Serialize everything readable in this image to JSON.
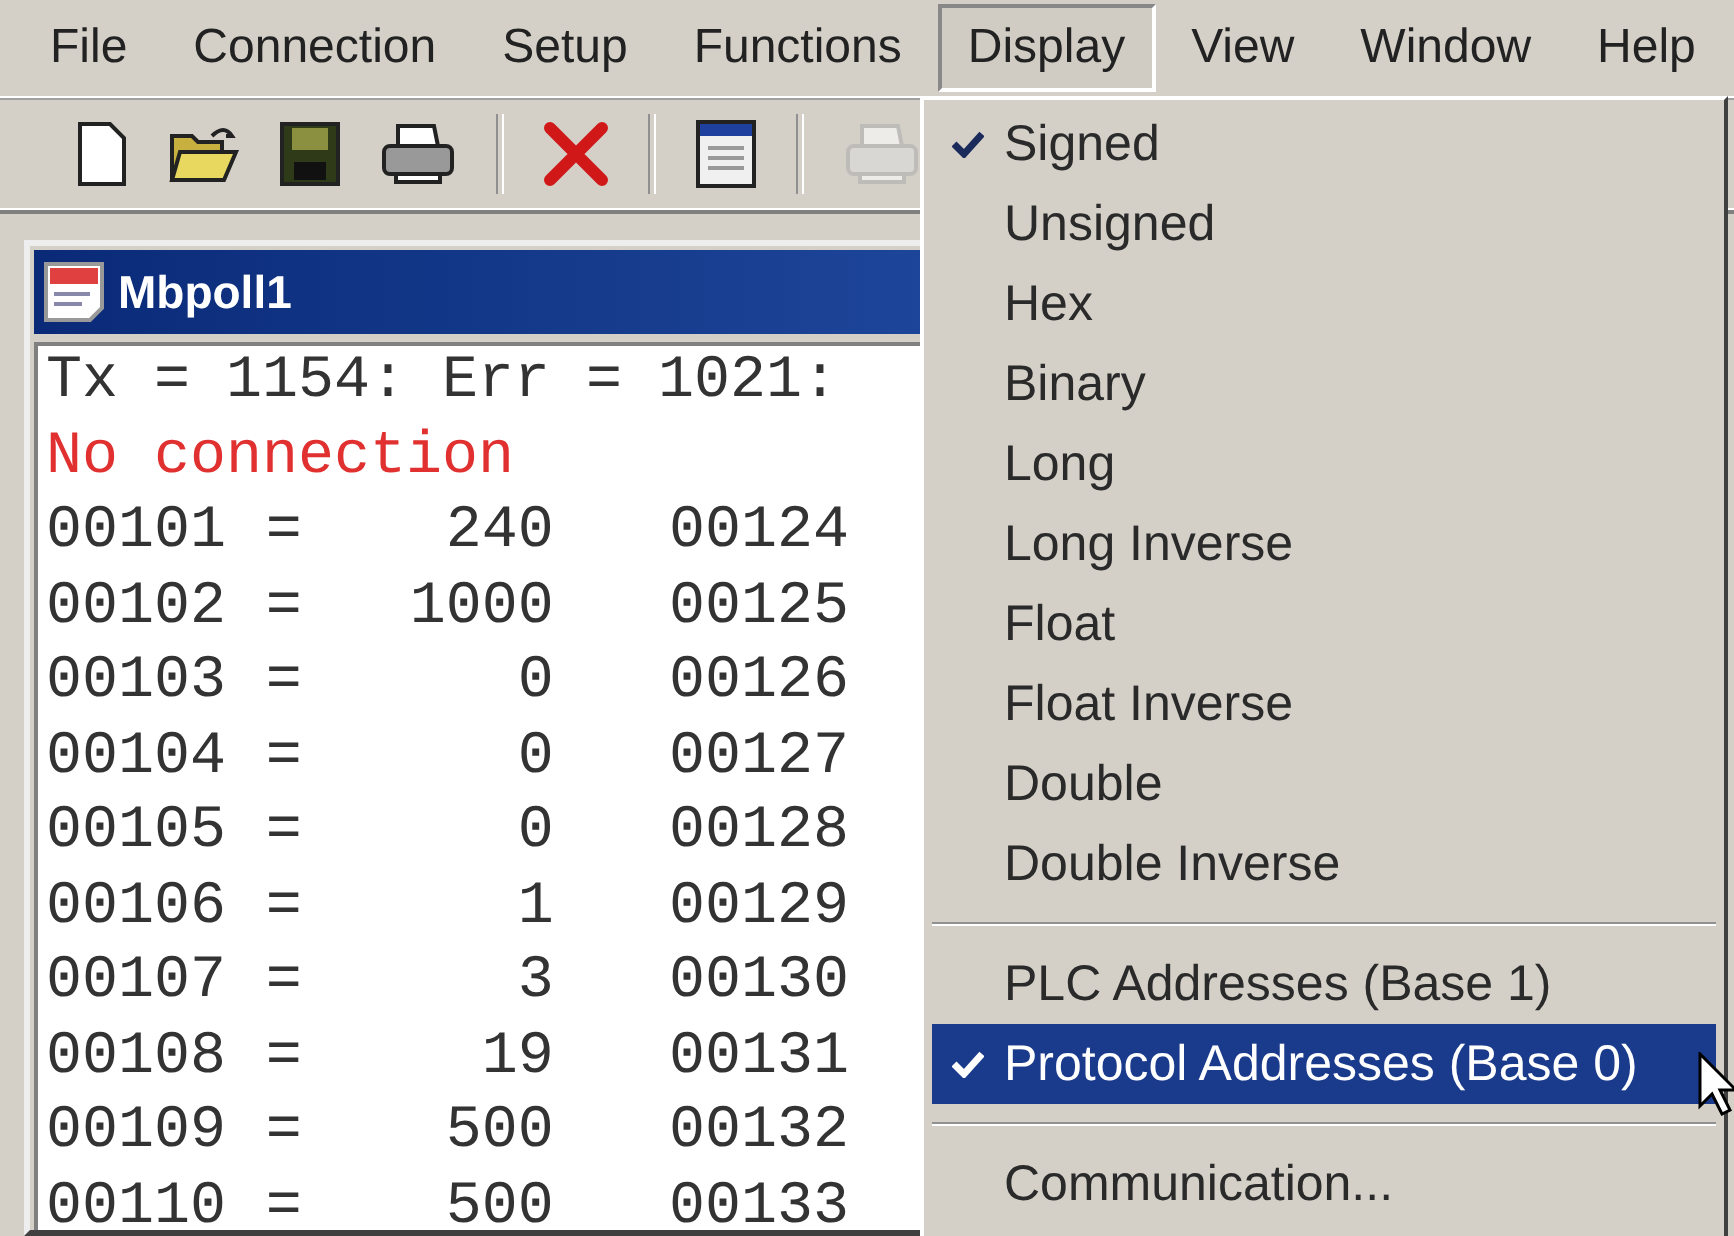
{
  "menubar": [
    {
      "label": "File",
      "selected": false
    },
    {
      "label": "Connection",
      "selected": false
    },
    {
      "label": "Setup",
      "selected": false
    },
    {
      "label": "Functions",
      "selected": false
    },
    {
      "label": "Display",
      "selected": true
    },
    {
      "label": "View",
      "selected": false
    },
    {
      "label": "Window",
      "selected": false
    },
    {
      "label": "Help",
      "selected": false
    }
  ],
  "toolbar": [
    {
      "kind": "new",
      "disabled": false
    },
    {
      "kind": "open",
      "disabled": false
    },
    {
      "kind": "save",
      "disabled": false
    },
    {
      "kind": "print",
      "disabled": false
    },
    {
      "kind": "separator"
    },
    {
      "kind": "delete",
      "disabled": false
    },
    {
      "kind": "separator"
    },
    {
      "kind": "window",
      "disabled": false
    },
    {
      "kind": "separator"
    },
    {
      "kind": "print",
      "disabled": true
    }
  ],
  "child_window": {
    "title": "Mbpoll1",
    "status": "Tx = 1154: Err = 1021:",
    "error": "No connection",
    "rows": [
      {
        "address": "00101",
        "sign": "=",
        "value": "240",
        "address_2": "00124"
      },
      {
        "address": "00102",
        "sign": "=",
        "value": "1000",
        "address_2": "00125"
      },
      {
        "address": "00103",
        "sign": "=",
        "value": "0",
        "address_2": "00126"
      },
      {
        "address": "00104",
        "sign": "=",
        "value": "0",
        "address_2": "00127"
      },
      {
        "address": "00105",
        "sign": "=",
        "value": "0",
        "address_2": "00128"
      },
      {
        "address": "00106",
        "sign": "=",
        "value": "1",
        "address_2": "00129"
      },
      {
        "address": "00107",
        "sign": "=",
        "value": "3",
        "address_2": "00130"
      },
      {
        "address": "00108",
        "sign": "=",
        "value": "19",
        "address_2": "00131"
      },
      {
        "address": "00109",
        "sign": "=",
        "value": "500",
        "address_2": "00132"
      },
      {
        "address": "00110",
        "sign": "=",
        "value": "500",
        "address_2": "00133"
      }
    ]
  },
  "display_menu": [
    {
      "kind": "item",
      "label": "Signed",
      "checked": true,
      "selected": false
    },
    {
      "kind": "item",
      "label": "Unsigned",
      "checked": false,
      "selected": false
    },
    {
      "kind": "item",
      "label": "Hex",
      "checked": false,
      "selected": false
    },
    {
      "kind": "item",
      "label": "Binary",
      "checked": false,
      "selected": false
    },
    {
      "kind": "item",
      "label": "Long",
      "checked": false,
      "selected": false
    },
    {
      "kind": "item",
      "label": "Long Inverse",
      "checked": false,
      "selected": false
    },
    {
      "kind": "item",
      "label": "Float",
      "checked": false,
      "selected": false
    },
    {
      "kind": "item",
      "label": "Float Inverse",
      "checked": false,
      "selected": false
    },
    {
      "kind": "item",
      "label": "Double",
      "checked": false,
      "selected": false
    },
    {
      "kind": "item",
      "label": "Double Inverse",
      "checked": false,
      "selected": false
    },
    {
      "kind": "separator"
    },
    {
      "kind": "item",
      "label": "PLC Addresses (Base 1)",
      "checked": false,
      "selected": false
    },
    {
      "kind": "item",
      "label": "Protocol Addresses (Base 0)",
      "checked": true,
      "selected": true
    },
    {
      "kind": "separator"
    },
    {
      "kind": "item",
      "label": "Communication...",
      "checked": false,
      "selected": false
    }
  ]
}
